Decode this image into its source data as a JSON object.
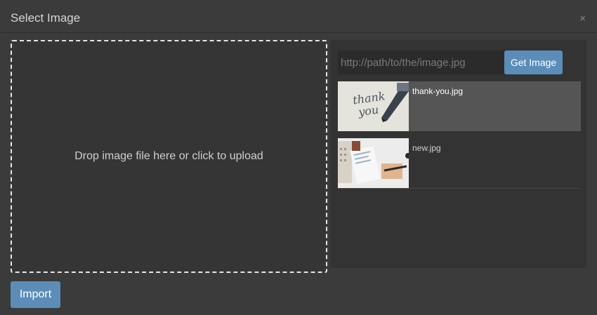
{
  "dialog": {
    "title": "Select Image",
    "close_symbol": "×"
  },
  "dropzone": {
    "text": "Drop image file here or click to upload"
  },
  "url": {
    "placeholder": "http://path/to/the/image.jpg",
    "button_label": "Get Image"
  },
  "files": [
    {
      "name": "thank-you.jpg",
      "selected": true
    },
    {
      "name": "new.jpg",
      "selected": false
    }
  ],
  "footer": {
    "import_label": "Import"
  },
  "colors": {
    "accent": "#5b8db8",
    "background": "#3b3b3b",
    "panel": "#333333",
    "selected_row": "#555555"
  }
}
